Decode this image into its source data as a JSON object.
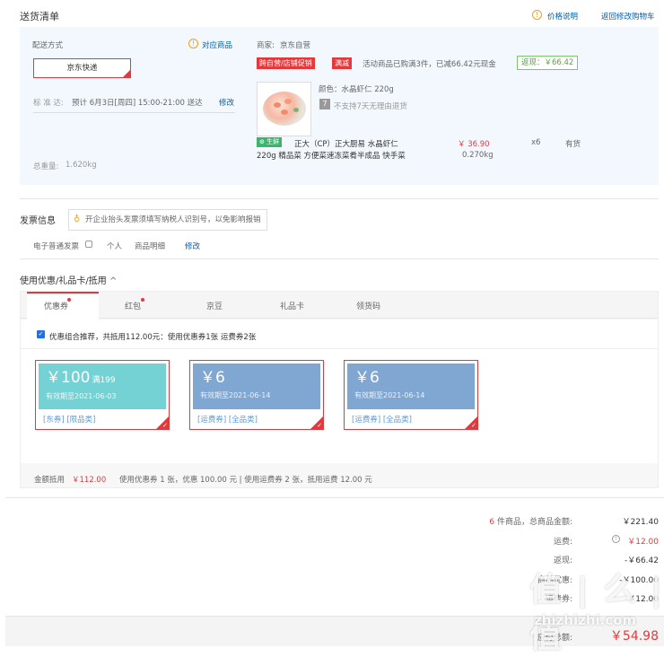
{
  "header": {
    "title": "送货清单",
    "price_note": "价格说明",
    "back_cart": "返回修改购物车"
  },
  "shipping": {
    "method_label": "配送方式",
    "method_value": "京东快递",
    "match_goods": "对应商品",
    "standard_label": "标 准 达:",
    "standard_value": "预计 6月3日[周四] 15:00-21:00 送达",
    "modify": "修改",
    "weight_label": "总重量:",
    "weight_value": "1.620kg"
  },
  "store": {
    "seller_label": "商家:",
    "seller_value": "京东自营",
    "tag1": "跨自营/店铺促销",
    "tag2": "满减",
    "promo_text": "活动商品已购满3件，已减66.42元现金",
    "rebate": "返现：￥66.42"
  },
  "product": {
    "color": "颜色：水晶虾仁 220g",
    "return_badge": "7",
    "return_text": "不支持7天无理由退货",
    "fresh_tag": "生鲜",
    "name_line1": "正大（CP）正大厨易 水晶虾仁",
    "name_line2": "220g 精品菜 方便菜速冻菜肴半成品 快手菜",
    "price": "￥ 36.90",
    "weight": "0.270kg",
    "qty": "x6",
    "stock": "有货"
  },
  "invoice": {
    "title": "发票信息",
    "tip": "开企业抬头发票须填写纳税人识别号，以免影响报销",
    "type": "电子普通发票",
    "person": "个人",
    "detail": "商品明细",
    "modify": "修改"
  },
  "coupon_section": {
    "title": "使用优惠/礼品卡/抵用",
    "tabs": [
      "优惠券",
      "红包",
      "京豆",
      "礼品卡",
      "领货码"
    ],
    "recommend": "优惠组合推荐，共抵用112.00元：使用优惠券1张 运费券2张",
    "summary_prefix": "金额抵用",
    "summary_amount": "￥112.00",
    "summary_text": "使用优惠券 1 张，优惠 100.00 元  | 使用运费券 2 张，抵用运费 12.00 元"
  },
  "coupons": [
    {
      "amount": "￥100",
      "cond": "满199",
      "expire": "有效期至2021-06-03",
      "tags": "[东券] [限品类]",
      "color": "#74d2d4"
    },
    {
      "amount": "￥6",
      "cond": "",
      "expire": "有效期至2021-06-14",
      "tags": "[运费券] [全品类]",
      "color": "#7fa7d1"
    },
    {
      "amount": "￥6",
      "cond": "",
      "expire": "有效期至2021-06-14",
      "tags": "[运费券] [全品类]",
      "color": "#7fa7d1"
    }
  ],
  "totals": {
    "count": "6",
    "count_text": "件商品，总商品金额:",
    "goods_total": "￥221.40",
    "freight_label": "运费:",
    "freight": "￥12.00",
    "rebate_label": "返现:",
    "rebate": "-￥66.42",
    "discount_label": "商品优惠:",
    "discount": "-￥100.00",
    "freight_coupon_label": "运费券:",
    "freight_coupon": "-￥12.00",
    "pay_label": "应付总额:",
    "pay": "￥54.98"
  },
  "watermark": "值 | 么 | 值",
  "watermark_url": "zhizhizhi.com"
}
